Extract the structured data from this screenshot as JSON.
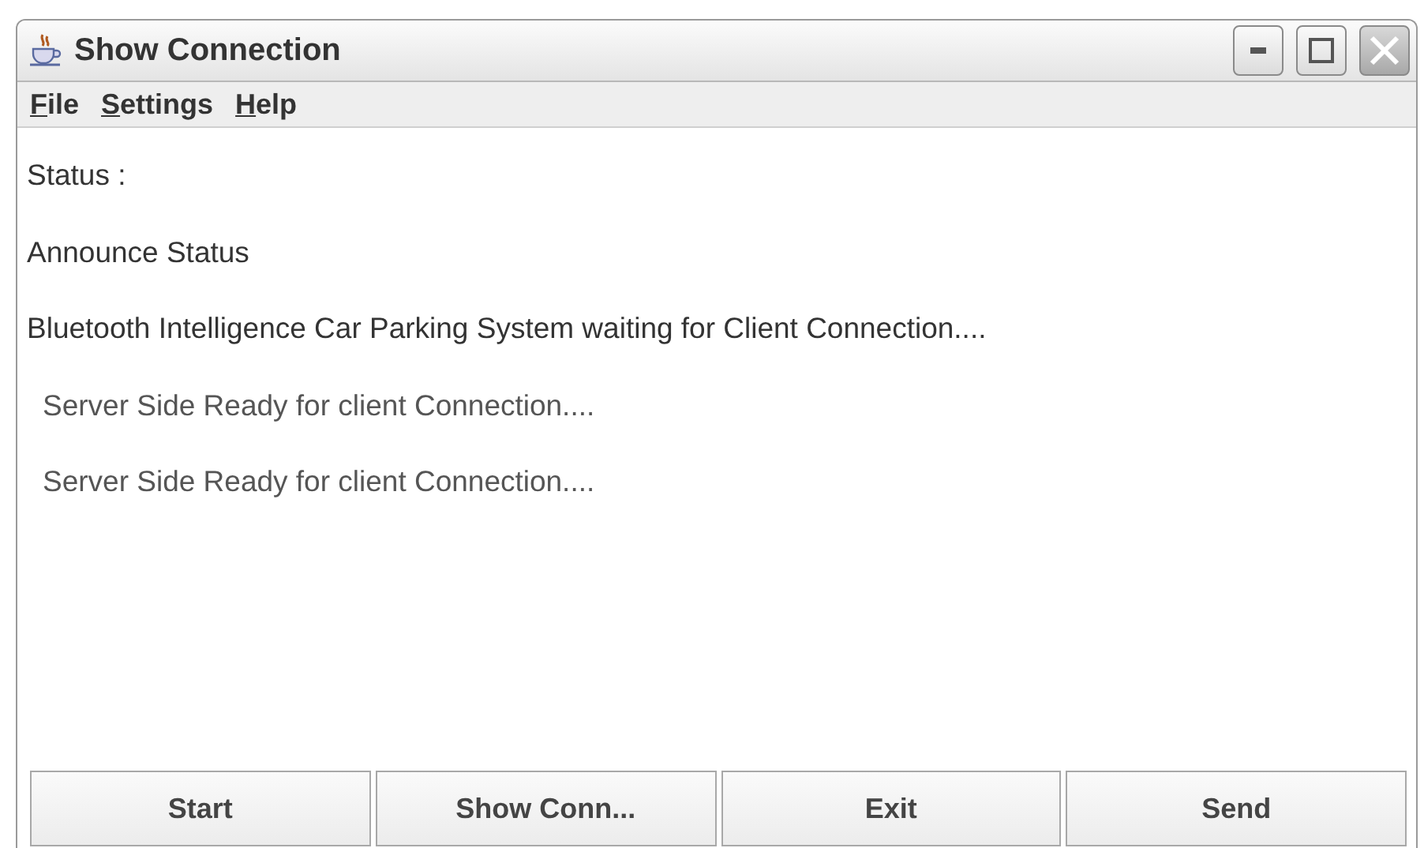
{
  "window": {
    "title": "Show Connection"
  },
  "menu": [
    "File",
    "Settings",
    "Help"
  ],
  "lines": [
    {
      "text": "Status :",
      "indented": false
    },
    {
      "text": "Announce Status",
      "indented": false
    },
    {
      "text": "Bluetooth Intelligence Car Parking System waiting for Client Connection....",
      "indented": false
    },
    {
      "text": "Server Side Ready for client Connection....",
      "indented": true
    },
    {
      "text": "Server Side Ready for client Connection....",
      "indented": true
    }
  ],
  "buttons": [
    "Start",
    "Show Conn...",
    "Exit",
    "Send"
  ]
}
